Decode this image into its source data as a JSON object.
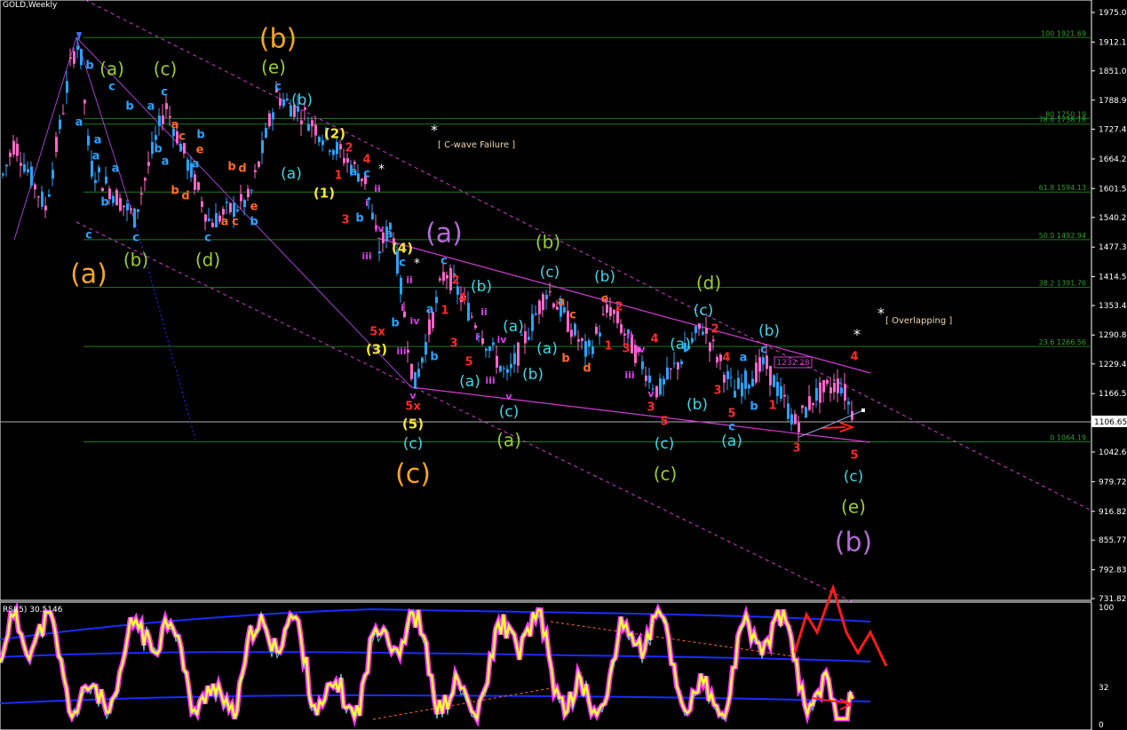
{
  "title": "GOLD,Weekly",
  "indicator_title": "RSI(5) 30.5146",
  "chart_data": {
    "type": "candlestick",
    "symbol": "GOLD",
    "timeframe": "Weekly",
    "ylim": [
      731.82,
      1975.0
    ],
    "last_price": "1106.65",
    "price_ticks": [
      "1975.00",
      "1912.12",
      "1851.07",
      "1788.99",
      "1727.42",
      "1664.27",
      "1601.53",
      "1540.27",
      "1477.37",
      "1414.57",
      "1353.42",
      "1290.89",
      "1229.47",
      "1166.57",
      "1106.65",
      "1042.66",
      "979.72",
      "916.82",
      "855.77",
      "792.83",
      "731.82"
    ],
    "fib_levels": [
      {
        "label": "100 1921.69",
        "value": 1921.69
      },
      {
        "label": "80 1750.19",
        "value": 1750.19
      },
      {
        "label": "78.6 1738.18",
        "value": 1738.18
      },
      {
        "label": "61.8 1594.13",
        "value": 1594.13
      },
      {
        "label": "50.0 1492.94",
        "value": 1492.94
      },
      {
        "label": "38.2 1391.76",
        "value": 1391.76
      },
      {
        "label": "23.6 1266.56",
        "value": 1266.56
      },
      {
        "label": "0 1064.19",
        "value": 1064.19
      }
    ],
    "price_box": "1232.28",
    "annotations": [
      {
        "text": "[ C-wave Failure ]",
        "star": "*"
      },
      {
        "text": "[ Overlapping ]",
        "star": "*"
      }
    ],
    "rsi_ticks": [
      "100",
      "32",
      "0"
    ],
    "wave_labels": [
      {
        "t": "(b)",
        "x": 313,
        "y": 45,
        "c": "#f5a623",
        "s": 30
      },
      {
        "t": "(e)",
        "x": 308,
        "y": 77,
        "c": "#9acd32",
        "s": 20
      },
      {
        "t": "(a)",
        "x": 126,
        "y": 79,
        "c": "#9acd32",
        "s": 20
      },
      {
        "t": "(c)",
        "x": 186,
        "y": 79,
        "c": "#9acd32",
        "s": 20
      },
      {
        "t": "(a)",
        "x": 100,
        "y": 310,
        "c": "#f5a623",
        "s": 30
      },
      {
        "t": "(b)",
        "x": 153,
        "y": 294,
        "c": "#9acd32",
        "s": 20
      },
      {
        "t": "(d)",
        "x": 234,
        "y": 294,
        "c": "#9acd32",
        "s": 20
      },
      {
        "t": "(a)",
        "x": 500,
        "y": 264,
        "c": "#b36bd4",
        "s": 30
      },
      {
        "t": "(b)",
        "x": 617,
        "y": 274,
        "c": "#9acd32",
        "s": 20
      },
      {
        "t": "(d)",
        "x": 798,
        "y": 320,
        "c": "#9acd32",
        "s": 20
      },
      {
        "t": "(c)",
        "x": 465,
        "y": 535,
        "c": "#f5a623",
        "s": 30
      },
      {
        "t": "(a)",
        "x": 573,
        "y": 497,
        "c": "#9acd32",
        "s": 20
      },
      {
        "t": "(c)",
        "x": 749,
        "y": 535,
        "c": "#9acd32",
        "s": 20
      },
      {
        "t": "(e)",
        "x": 961,
        "y": 572,
        "c": "#9acd32",
        "s": 20
      },
      {
        "t": "(b)",
        "x": 961,
        "y": 612,
        "c": "#b36bd4",
        "s": 30
      },
      {
        "t": "(b)",
        "x": 340,
        "y": 113,
        "c": "#3fd6e6",
        "s": 17
      },
      {
        "t": "(a)",
        "x": 328,
        "y": 196,
        "c": "#3fd6e6",
        "s": 17
      },
      {
        "t": "(c)",
        "x": 619,
        "y": 307,
        "c": "#3fd6e6",
        "s": 17
      },
      {
        "t": "(b)",
        "x": 681,
        "y": 312,
        "c": "#3fd6e6",
        "s": 17
      },
      {
        "t": "(b)",
        "x": 542,
        "y": 323,
        "c": "#3fd6e6",
        "s": 17
      },
      {
        "t": "(a)",
        "x": 578,
        "y": 368,
        "c": "#3fd6e6",
        "s": 17
      },
      {
        "t": "(a)",
        "x": 616,
        "y": 393,
        "c": "#3fd6e6",
        "s": 17
      },
      {
        "t": "(b)",
        "x": 600,
        "y": 422,
        "c": "#3fd6e6",
        "s": 17
      },
      {
        "t": "(a)",
        "x": 529,
        "y": 430,
        "c": "#3fd6e6",
        "s": 17
      },
      {
        "t": "(c)",
        "x": 573,
        "y": 464,
        "c": "#3fd6e6",
        "s": 17
      },
      {
        "t": "(c)",
        "x": 465,
        "y": 500,
        "c": "#3fd6e6",
        "s": 17
      },
      {
        "t": "(c)",
        "x": 792,
        "y": 350,
        "c": "#3fd6e6",
        "s": 17
      },
      {
        "t": "(a)",
        "x": 766,
        "y": 388,
        "c": "#3fd6e6",
        "s": 17
      },
      {
        "t": "(b)",
        "x": 785,
        "y": 456,
        "c": "#3fd6e6",
        "s": 17
      },
      {
        "t": "(c)",
        "x": 748,
        "y": 500,
        "c": "#3fd6e6",
        "s": 17
      },
      {
        "t": "(a)",
        "x": 824,
        "y": 497,
        "c": "#3fd6e6",
        "s": 17
      },
      {
        "t": "(b)",
        "x": 866,
        "y": 373,
        "c": "#3fd6e6",
        "s": 17
      },
      {
        "t": "(c)",
        "x": 961,
        "y": 537,
        "c": "#3fd6e6",
        "s": 17
      },
      {
        "t": "(2)",
        "x": 377,
        "y": 151,
        "c": "#f3e635",
        "s": 15
      },
      {
        "t": "(1)",
        "x": 365,
        "y": 218,
        "c": "#f3e635",
        "s": 15
      },
      {
        "t": "(4)",
        "x": 453,
        "y": 280,
        "c": "#f3e635",
        "s": 15
      },
      {
        "t": "(3)",
        "x": 424,
        "y": 394,
        "c": "#f3e635",
        "s": 15
      },
      {
        "t": "(5)",
        "x": 465,
        "y": 478,
        "c": "#f3e635",
        "s": 15
      },
      {
        "t": "b",
        "x": 101,
        "y": 74,
        "c": "#29a3ff",
        "s": 13
      },
      {
        "t": "a",
        "x": 89,
        "y": 138,
        "c": "#29a3ff",
        "s": 13
      },
      {
        "t": "c",
        "x": 126,
        "y": 98,
        "c": "#29a3ff",
        "s": 13
      },
      {
        "t": "b",
        "x": 146,
        "y": 120,
        "c": "#29a3ff",
        "s": 13
      },
      {
        "t": "a",
        "x": 170,
        "y": 120,
        "c": "#29a3ff",
        "s": 13
      },
      {
        "t": "c",
        "x": 185,
        "y": 104,
        "c": "#29a3ff",
        "s": 13
      },
      {
        "t": "a",
        "x": 110,
        "y": 158,
        "c": "#29a3ff",
        "s": 13
      },
      {
        "t": "a",
        "x": 108,
        "y": 176,
        "c": "#29a3ff",
        "s": 13
      },
      {
        "t": "a",
        "x": 130,
        "y": 190,
        "c": "#29a3ff",
        "s": 13
      },
      {
        "t": "b",
        "x": 118,
        "y": 228,
        "c": "#29a3ff",
        "s": 13
      },
      {
        "t": "c",
        "x": 100,
        "y": 265,
        "c": "#29a3ff",
        "s": 13
      },
      {
        "t": "c",
        "x": 153,
        "y": 268,
        "c": "#29a3ff",
        "s": 13
      },
      {
        "t": "b",
        "x": 178,
        "y": 168,
        "c": "#29a3ff",
        "s": 13
      },
      {
        "t": "a",
        "x": 186,
        "y": 182,
        "c": "#29a3ff",
        "s": 13
      },
      {
        "t": "b",
        "x": 226,
        "y": 152,
        "c": "#29a3ff",
        "s": 13
      },
      {
        "t": "a",
        "x": 220,
        "y": 185,
        "c": "#29a3ff",
        "s": 13
      },
      {
        "t": "c",
        "x": 234,
        "y": 268,
        "c": "#29a3ff",
        "s": 13
      },
      {
        "t": "b",
        "x": 286,
        "y": 250,
        "c": "#29a3ff",
        "s": 13
      },
      {
        "t": "c",
        "x": 313,
        "y": 98,
        "c": "#29a3ff",
        "s": 13
      },
      {
        "t": "a",
        "x": 398,
        "y": 194,
        "c": "#29a3ff",
        "s": 13
      },
      {
        "t": "c",
        "x": 413,
        "y": 196,
        "c": "#29a3ff",
        "s": 13
      },
      {
        "t": "b",
        "x": 405,
        "y": 246,
        "c": "#29a3ff",
        "s": 13
      },
      {
        "t": "a",
        "x": 438,
        "y": 264,
        "c": "#29a3ff",
        "s": 13
      },
      {
        "t": "c",
        "x": 453,
        "y": 296,
        "c": "#29a3ff",
        "s": 13
      },
      {
        "t": "b",
        "x": 445,
        "y": 364,
        "c": "#29a3ff",
        "s": 13
      },
      {
        "t": "c",
        "x": 500,
        "y": 294,
        "c": "#29a3ff",
        "s": 13
      },
      {
        "t": "a",
        "x": 484,
        "y": 349,
        "c": "#29a3ff",
        "s": 13
      },
      {
        "t": "b",
        "x": 489,
        "y": 402,
        "c": "#29a3ff",
        "s": 13
      },
      {
        "t": "a",
        "x": 837,
        "y": 403,
        "c": "#29a3ff",
        "s": 13
      },
      {
        "t": "c",
        "x": 860,
        "y": 394,
        "c": "#29a3ff",
        "s": 13
      },
      {
        "t": "b",
        "x": 849,
        "y": 458,
        "c": "#29a3ff",
        "s": 13
      },
      {
        "t": "c",
        "x": 824,
        "y": 481,
        "c": "#29a3ff",
        "s": 13
      },
      {
        "t": "a",
        "x": 197,
        "y": 141,
        "c": "#ff6a2b",
        "s": 13
      },
      {
        "t": "c",
        "x": 205,
        "y": 154,
        "c": "#ff6a2b",
        "s": 13
      },
      {
        "t": "b",
        "x": 197,
        "y": 215,
        "c": "#ff6a2b",
        "s": 13
      },
      {
        "t": "d",
        "x": 209,
        "y": 221,
        "c": "#ff6a2b",
        "s": 13
      },
      {
        "t": "e",
        "x": 225,
        "y": 169,
        "c": "#ff6a2b",
        "s": 13
      },
      {
        "t": "b",
        "x": 261,
        "y": 188,
        "c": "#ff6a2b",
        "s": 13
      },
      {
        "t": "d",
        "x": 273,
        "y": 190,
        "c": "#ff6a2b",
        "s": 13
      },
      {
        "t": "a",
        "x": 253,
        "y": 250,
        "c": "#ff6a2b",
        "s": 13
      },
      {
        "t": "c",
        "x": 265,
        "y": 250,
        "c": "#ff6a2b",
        "s": 13
      },
      {
        "t": "e",
        "x": 286,
        "y": 233,
        "c": "#ff6a2b",
        "s": 13
      },
      {
        "t": "e",
        "x": 681,
        "y": 337,
        "c": "#ff6a2b",
        "s": 13
      },
      {
        "t": "a",
        "x": 632,
        "y": 340,
        "c": "#ff6a2b",
        "s": 13
      },
      {
        "t": "c",
        "x": 645,
        "y": 355,
        "c": "#ff6a2b",
        "s": 13
      },
      {
        "t": "b",
        "x": 637,
        "y": 404,
        "c": "#ff6a2b",
        "s": 13
      },
      {
        "t": "d",
        "x": 661,
        "y": 415,
        "c": "#ff6a2b",
        "s": 13
      },
      {
        "t": "2",
        "x": 393,
        "y": 167,
        "c": "#ff2a2a",
        "s": 13
      },
      {
        "t": "1",
        "x": 381,
        "y": 198,
        "c": "#ff2a2a",
        "s": 13
      },
      {
        "t": "3",
        "x": 389,
        "y": 248,
        "c": "#ff2a2a",
        "s": 13
      },
      {
        "t": "4",
        "x": 413,
        "y": 180,
        "c": "#ff2a2a",
        "s": 13
      },
      {
        "t": "5x",
        "x": 425,
        "y": 374,
        "c": "#ff2a2a",
        "s": 13
      },
      {
        "t": "5x",
        "x": 465,
        "y": 458,
        "c": "#ff2a2a",
        "s": 13
      },
      {
        "t": "2",
        "x": 513,
        "y": 316,
        "c": "#ff2a2a",
        "s": 13
      },
      {
        "t": "4",
        "x": 521,
        "y": 336,
        "c": "#ff2a2a",
        "s": 13
      },
      {
        "t": "1",
        "x": 501,
        "y": 350,
        "c": "#ff2a2a",
        "s": 13
      },
      {
        "t": "3",
        "x": 511,
        "y": 387,
        "c": "#ff2a2a",
        "s": 13
      },
      {
        "t": "5",
        "x": 528,
        "y": 408,
        "c": "#ff2a2a",
        "s": 13
      },
      {
        "t": "2",
        "x": 697,
        "y": 346,
        "c": "#ff2a2a",
        "s": 13
      },
      {
        "t": "1",
        "x": 685,
        "y": 390,
        "c": "#ff2a2a",
        "s": 13
      },
      {
        "t": "3",
        "x": 705,
        "y": 393,
        "c": "#ff2a2a",
        "s": 13
      },
      {
        "t": "4",
        "x": 737,
        "y": 382,
        "c": "#ff2a2a",
        "s": 13
      },
      {
        "t": "3",
        "x": 733,
        "y": 459,
        "c": "#ff2a2a",
        "s": 13
      },
      {
        "t": "5",
        "x": 748,
        "y": 475,
        "c": "#ff2a2a",
        "s": 13
      },
      {
        "t": "2",
        "x": 805,
        "y": 371,
        "c": "#ff2a2a",
        "s": 13
      },
      {
        "t": "4",
        "x": 818,
        "y": 403,
        "c": "#ff2a2a",
        "s": 13
      },
      {
        "t": "3",
        "x": 808,
        "y": 440,
        "c": "#ff2a2a",
        "s": 13
      },
      {
        "t": "5",
        "x": 824,
        "y": 466,
        "c": "#ff2a2a",
        "s": 13
      },
      {
        "t": "1",
        "x": 870,
        "y": 457,
        "c": "#ff2a2a",
        "s": 13
      },
      {
        "t": "3",
        "x": 897,
        "y": 505,
        "c": "#ff2a2a",
        "s": 13
      },
      {
        "t": "4",
        "x": 962,
        "y": 402,
        "c": "#ff2a2a",
        "s": 13
      },
      {
        "t": "5",
        "x": 962,
        "y": 513,
        "c": "#ff2a2a",
        "s": 13
      },
      {
        "t": "ii",
        "x": 425,
        "y": 213,
        "c": "#e03cf0",
        "s": 11
      },
      {
        "t": "i",
        "x": 413,
        "y": 229,
        "c": "#e03cf0",
        "s": 11
      },
      {
        "t": "iv",
        "x": 427,
        "y": 258,
        "c": "#e03cf0",
        "s": 11
      },
      {
        "t": "iii",
        "x": 413,
        "y": 289,
        "c": "#e03cf0",
        "s": 11
      },
      {
        "t": "ii",
        "x": 461,
        "y": 316,
        "c": "#e03cf0",
        "s": 11
      },
      {
        "t": "i",
        "x": 453,
        "y": 347,
        "c": "#e03cf0",
        "s": 11
      },
      {
        "t": "iv",
        "x": 467,
        "y": 362,
        "c": "#e03cf0",
        "s": 11
      },
      {
        "t": "iii",
        "x": 452,
        "y": 396,
        "c": "#e03cf0",
        "s": 11
      },
      {
        "t": "v",
        "x": 465,
        "y": 446,
        "c": "#e03cf0",
        "s": 11
      },
      {
        "t": "ii",
        "x": 545,
        "y": 352,
        "c": "#e03cf0",
        "s": 11
      },
      {
        "t": "i",
        "x": 537,
        "y": 380,
        "c": "#e03cf0",
        "s": 11
      },
      {
        "t": "iv",
        "x": 565,
        "y": 383,
        "c": "#e03cf0",
        "s": 11
      },
      {
        "t": "iii",
        "x": 552,
        "y": 429,
        "c": "#e03cf0",
        "s": 11
      },
      {
        "t": "v",
        "x": 573,
        "y": 447,
        "c": "#e03cf0",
        "s": 11
      },
      {
        "t": "ii",
        "x": 709,
        "y": 378,
        "c": "#e03cf0",
        "s": 11
      },
      {
        "t": "iv",
        "x": 721,
        "y": 394,
        "c": "#e03cf0",
        "s": 11
      },
      {
        "t": "iii",
        "x": 709,
        "y": 423,
        "c": "#e03cf0",
        "s": 11
      },
      {
        "t": "v",
        "x": 733,
        "y": 444,
        "c": "#e03cf0",
        "s": 11
      }
    ]
  }
}
